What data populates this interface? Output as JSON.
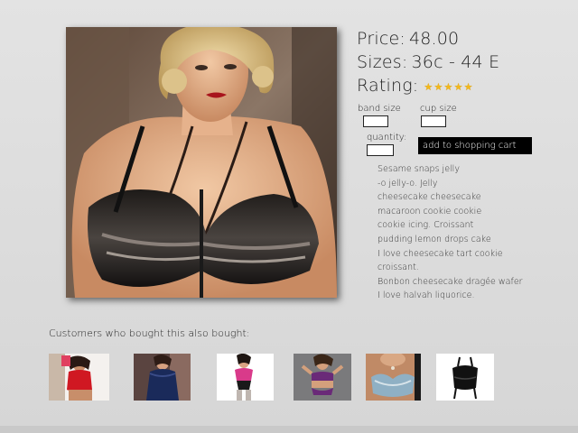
{
  "product": {
    "price_label": "Price:",
    "price_value": "48.00",
    "sizes_label": "Sizes:",
    "sizes_value": "36c - 44 E",
    "rating_label": "Rating:",
    "rating_stars": 5,
    "rating_max": 5,
    "star_color": "#f3b81a",
    "image_icon": "product-photo"
  },
  "form": {
    "band_size_label": "band size",
    "cup_size_label": "cup size",
    "quantity_label": "quantity:",
    "band_size_value": "",
    "cup_size_value": "",
    "quantity_value": "",
    "add_to_cart_label": "add to shopping cart"
  },
  "description": {
    "lines": [
      "Sesame snaps jelly",
      "-o jelly-o. Jelly",
      "cheesecake cheesecake",
      "macaroon cookie cookie",
      " cookie icing. Croissant",
      "pudding lemon drops cake",
      "I love cheesecake tart cookie",
      "croissant.",
      "Bonbon cheesecake dragée wafer",
      "I love halvah liquorice."
    ]
  },
  "related": {
    "heading": "Customers who bought this also bought:",
    "items": [
      {
        "icon": "red-corset-thumbnail"
      },
      {
        "icon": "navy-babydoll-thumbnail"
      },
      {
        "icon": "pink-teddy-thumbnail"
      },
      {
        "icon": "purple-bra-set-thumbnail"
      },
      {
        "icon": "lace-bra-thumbnail"
      },
      {
        "icon": "black-bustier-thumbnail"
      }
    ]
  },
  "colors": {
    "background": "#dcdcdc",
    "button_bg": "#000000",
    "button_text": "#ffffff",
    "text": "#222222"
  }
}
